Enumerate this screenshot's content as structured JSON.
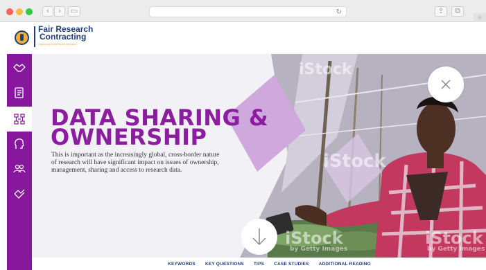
{
  "browser": {
    "reload_glyph": "↻",
    "plus_glyph": "+"
  },
  "logo": {
    "line1": "Fair Research",
    "line2": "Contracting",
    "tagline": "Optimising Global Health Innovation"
  },
  "sidebar": {
    "items": [
      {
        "icon": "handshake-icon",
        "active": false
      },
      {
        "icon": "document-icon",
        "active": false
      },
      {
        "icon": "network-icon",
        "active": true
      },
      {
        "icon": "head-icon",
        "active": false
      },
      {
        "icon": "people-icon",
        "active": false
      },
      {
        "icon": "agreement-icon",
        "active": false
      }
    ]
  },
  "hero": {
    "title_line1": "DATA SHARING &",
    "title_line2": "OWNERSHIP",
    "description": "This is important as the increasingly global, cross-border nature of research will have significant impact on issues of ownership, management, sharing and access to research data.",
    "watermark": "iStock",
    "watermark_sub": "by Getty Images"
  },
  "bottom_nav": {
    "items": [
      "KEYWORDS",
      "KEY QUESTIONS",
      "TIPS",
      "CASE STUDIES",
      "ADDITIONAL READING"
    ]
  },
  "colors": {
    "brand_purple": "#87179c",
    "brand_blue": "#1f3d7a",
    "brand_gold": "#ecb13b"
  }
}
